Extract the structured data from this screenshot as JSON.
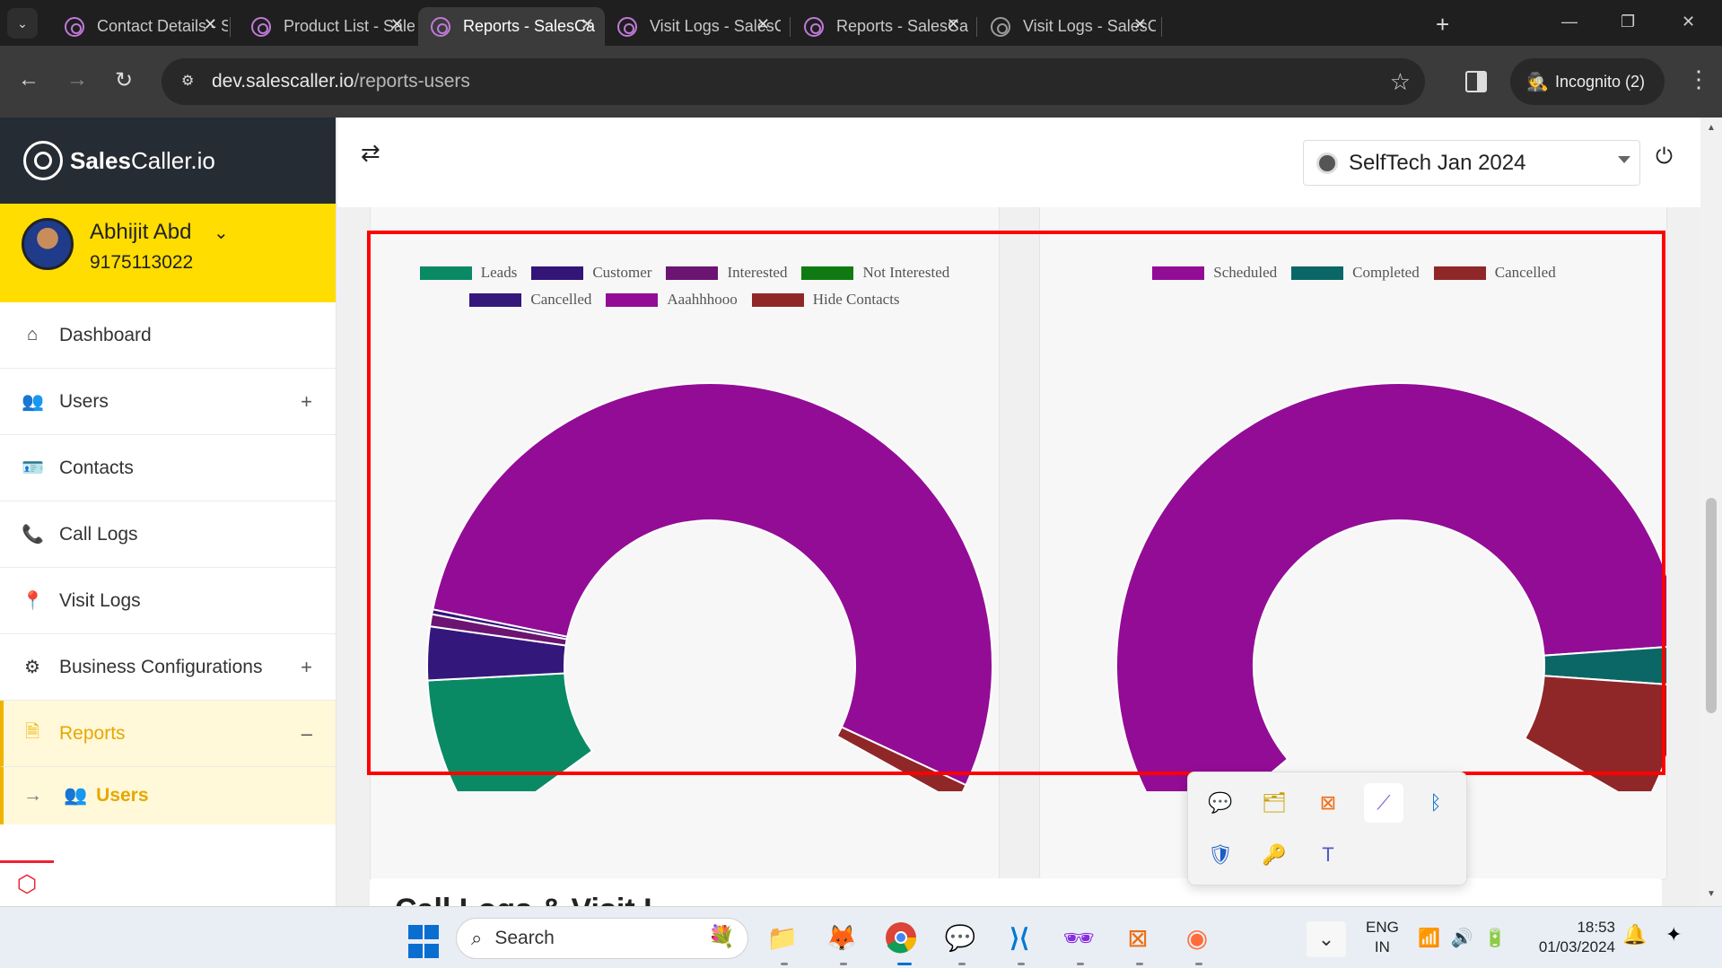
{
  "browser": {
    "tabs": [
      {
        "title": "Contact Details - S",
        "active": false
      },
      {
        "title": "Product List - Sale",
        "active": false
      },
      {
        "title": "Reports - SalesCall",
        "active": true
      },
      {
        "title": "Visit Logs - SalesC",
        "active": false
      },
      {
        "title": "Reports - SalesCall",
        "active": false
      },
      {
        "title": "Visit Logs - SalesC",
        "active": false
      }
    ],
    "url_host": "dev.salescaller.io",
    "url_path": "/reports-users",
    "incognito_label": "Incognito (2)"
  },
  "brand": {
    "name_bold": "Sales",
    "name_rest": "Caller.io"
  },
  "user": {
    "name": "Abhijit Abd",
    "phone": "9175113022"
  },
  "nav": {
    "items": [
      {
        "label": "Dashboard",
        "icon": "home-icon"
      },
      {
        "label": "Users",
        "icon": "users-icon",
        "expand": "+"
      },
      {
        "label": "Contacts",
        "icon": "contacts-card-icon"
      },
      {
        "label": "Call Logs",
        "icon": "phone-icon"
      },
      {
        "label": "Visit Logs",
        "icon": "location-pin-icon"
      },
      {
        "label": "Business Configurations",
        "icon": "gear-icon",
        "expand": "+"
      },
      {
        "label": "Reports",
        "icon": "document-icon",
        "expand": "–"
      }
    ],
    "sub_item": {
      "label": "Users",
      "icon": "users-icon"
    }
  },
  "header": {
    "company": "SelfTech Jan 2024"
  },
  "charts": {
    "left": {
      "type": "pie",
      "legend": [
        {
          "label": "Leads",
          "color": "#0a8a64"
        },
        {
          "label": "Customer",
          "color": "#331477"
        },
        {
          "label": "Interested",
          "color": "#6c1472"
        },
        {
          "label": "Not Interested",
          "color": "#0f7a11"
        },
        {
          "label": "Cancelled",
          "color": "#34177b"
        },
        {
          "label": "Aaahhhooo",
          "color": "#930c96"
        },
        {
          "label": "Hide Contacts",
          "color": "#8f2729"
        }
      ]
    },
    "right": {
      "type": "pie",
      "legend": [
        {
          "label": "Scheduled",
          "color": "#930c96"
        },
        {
          "label": "Completed",
          "color": "#0b6766"
        },
        {
          "label": "Cancelled",
          "color": "#8f2729"
        }
      ]
    }
  },
  "section_below": {
    "title": "Call Logs & Visit L"
  },
  "tray": {
    "icons": [
      "feedback-icon",
      "file-manager-icon",
      "xampp-icon",
      "pen-icon",
      "bluetooth-icon",
      "defender-warning-icon",
      "key-search-icon",
      "teams-icon"
    ]
  },
  "taskbar": {
    "search_placeholder": "Search",
    "lang_top": "ENG",
    "lang_bottom": "IN",
    "time": "18:53",
    "date": "01/03/2024"
  }
}
